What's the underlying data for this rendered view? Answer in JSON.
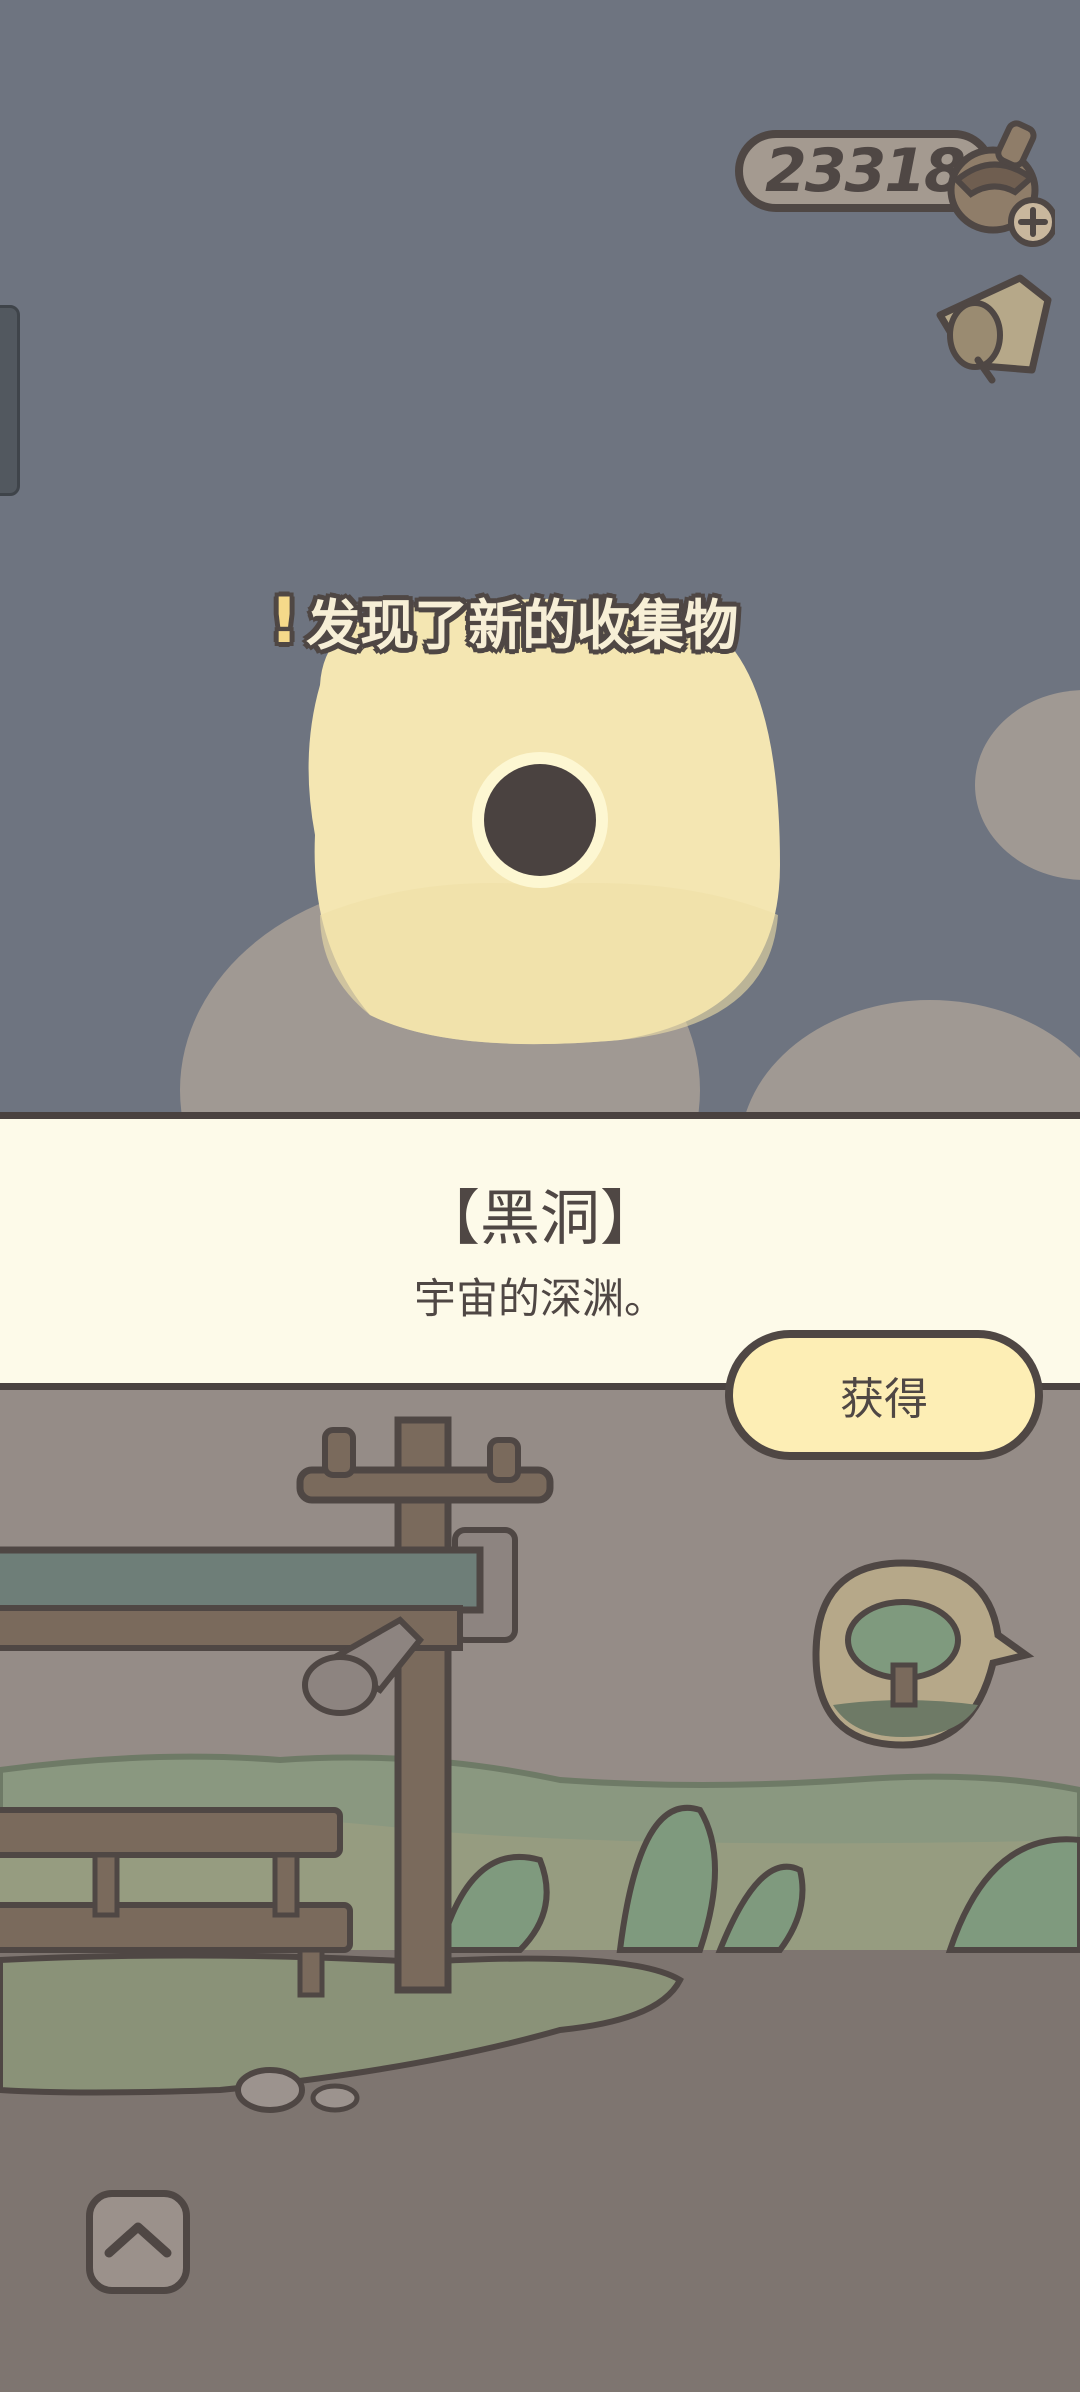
{
  "hud": {
    "acorn_count": "233184",
    "acorn_icon": "acorn-icon",
    "add_icon": "plus-icon",
    "feedback_icon": "megaphone-icon",
    "scene_icon": "tree-icon"
  },
  "discovery": {
    "mark": "!",
    "text": "发现了新的收集物"
  },
  "item": {
    "name": "【黑洞】",
    "description": "宇宙的深渊。"
  },
  "actions": {
    "obtain_label": "获得",
    "up_icon": "chevron-up-icon"
  },
  "colors": {
    "sky": "#6e7480",
    "outline": "#4f4744",
    "glow": "#f4e6b2",
    "panel": "#fdfae9",
    "button": "#fdeeb5",
    "ground": "#7e7570"
  }
}
